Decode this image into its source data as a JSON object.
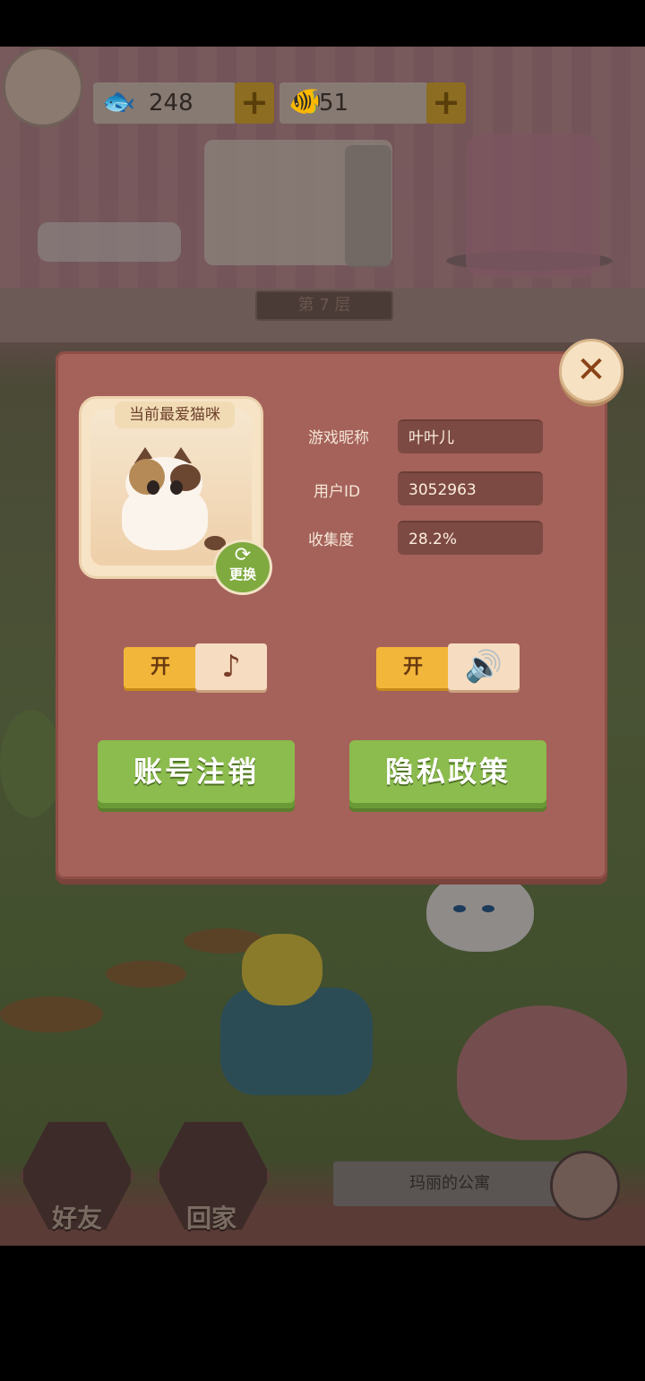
{
  "hud": {
    "fish_count": "248",
    "gold_fish_count": "51",
    "fish_icon": "🐟",
    "gold_fish_icon": "🐠",
    "plus_label": "+"
  },
  "room": {
    "floor_label": "第 7 层"
  },
  "profile_dialog": {
    "close_label": "✕",
    "favorite_cat_title": "当前最爱猫咪",
    "change_label": "更换",
    "change_icon": "⟳",
    "fields": [
      {
        "label": "游戏昵称",
        "value": "叶叶儿"
      },
      {
        "label": "用户ID",
        "value": "3052963"
      },
      {
        "label": "收集度",
        "value": "28.2%"
      }
    ],
    "music_toggle": {
      "state_label": "开",
      "icon": "♪"
    },
    "sound_toggle": {
      "state_label": "开",
      "icon": "🔊"
    },
    "cancel_account_label": "账号注销",
    "privacy_policy_label": "隐私政策"
  },
  "bottom_nav": {
    "friends_label": "好友",
    "home_label": "回家",
    "location_label": "玛丽的公寓"
  },
  "colors": {
    "dialog_bg": "#a5625a",
    "button_green": "#8cbb4e",
    "toggle_on": "#f2b63a"
  }
}
